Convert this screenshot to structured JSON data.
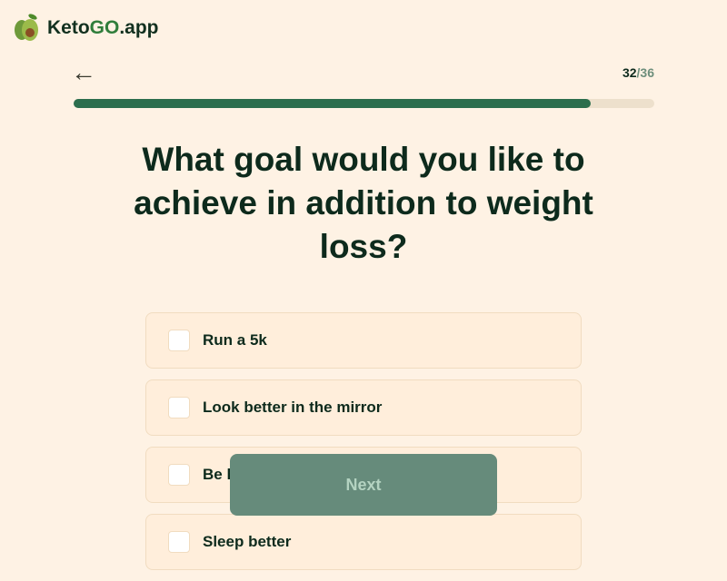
{
  "brand": {
    "name_prefix": "Keto",
    "name_go": "GO",
    "name_suffix": ".app"
  },
  "progress": {
    "current": "32",
    "separator": "/",
    "total": "36",
    "fraction": 0.89
  },
  "question": "What goal would you like to achieve in addition to weight loss?",
  "options": [
    {
      "label": "Run a 5k",
      "checked": false
    },
    {
      "label": "Look better in the mirror",
      "checked": false
    },
    {
      "label": "Be healthier",
      "checked": false
    },
    {
      "label": "Sleep better",
      "checked": false
    }
  ],
  "next_label": "Next",
  "colors": {
    "accent": "#2c6e4d",
    "background": "#fef2e4",
    "button": "#668b7b"
  }
}
